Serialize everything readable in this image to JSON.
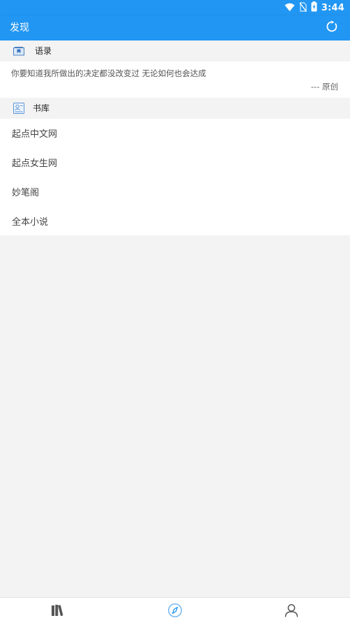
{
  "status_bar": {
    "time": "3:44",
    "icons": [
      "wifi-icon",
      "no-sim-icon",
      "battery-charging-icon"
    ]
  },
  "app_bar": {
    "title": "发现",
    "action_icon": "refresh-icon"
  },
  "quotes_section": {
    "title": "语录",
    "icon": "quote-book-icon",
    "quote_text": "你要知道我所做出的决定都没改变过 无论如何也会达成",
    "quote_source": "--- 原创"
  },
  "library_section": {
    "title": "书库",
    "icon": "library-icon",
    "items": [
      {
        "label": "起点中文网"
      },
      {
        "label": "起点女生网"
      },
      {
        "label": "妙笔阁"
      },
      {
        "label": "全本小说"
      }
    ]
  },
  "bottom_nav": {
    "items": [
      {
        "icon": "bookshelf-icon",
        "active": false
      },
      {
        "icon": "compass-icon",
        "active": true
      },
      {
        "icon": "person-icon",
        "active": false
      }
    ]
  },
  "colors": {
    "primary": "#2196f3",
    "background": "#f3f3f3",
    "card": "#ffffff",
    "nav_inactive": "#555555",
    "nav_active": "#2196f3"
  }
}
